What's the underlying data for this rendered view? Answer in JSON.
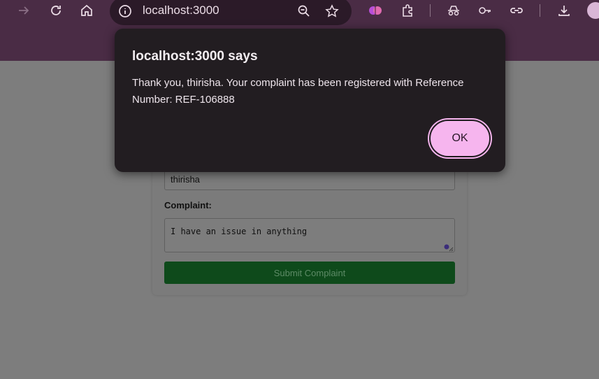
{
  "browser": {
    "url": "localhost:3000",
    "accent_color": "#4a2c45"
  },
  "form": {
    "name_value": "thirisha",
    "complaint_label": "Complaint:",
    "complaint_value": "I have an issue in anything",
    "submit_label": "Submit Complaint"
  },
  "dialog": {
    "title": "localhost:3000 says",
    "message": "Thank you, thirisha. Your complaint has been registered with Reference Number: REF-106888",
    "ok_label": "OK"
  }
}
